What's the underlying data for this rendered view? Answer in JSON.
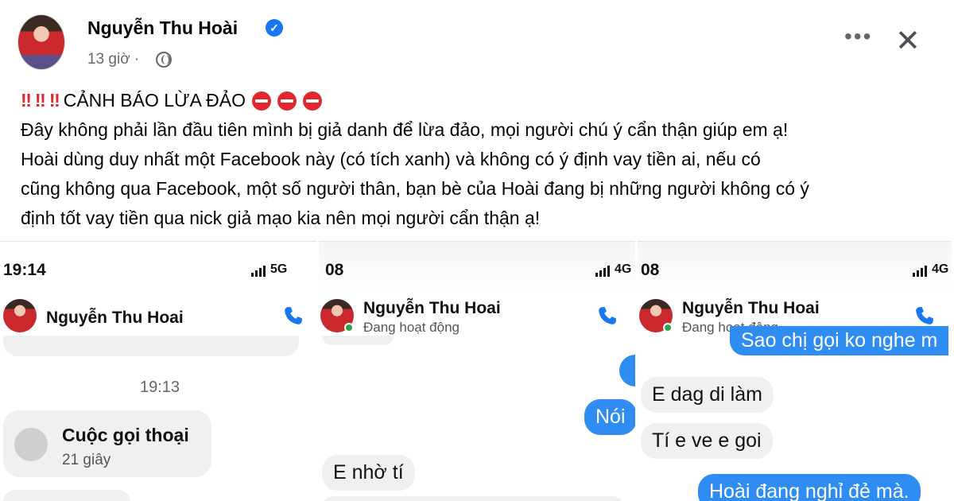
{
  "post": {
    "author": "Nguyễn Thu Hoài",
    "time": "13 giờ",
    "warning_title": "CẢNH BÁO LỪA ĐẢO",
    "lines": [
      "Đây không phải lần đầu tiên mình bị giả danh để lừa đảo, mọi người chú ý cẩn thận giúp em ạ!",
      "Hoài dùng duy nhất một Facebook này (có tích xanh) và không có ý định vay tiền ai, nếu có",
      "cũng không qua Facebook, một số người thân, bạn bè của Hoài đang bị những người không có ý",
      "định tốt vay tiền qua nick giả mạo kia nên mọi người cẩn thận ạ!"
    ],
    "accent_color": "#1877f2",
    "alert_color": "#e0262f"
  },
  "screenshots": [
    {
      "status_time": "19:14",
      "network": "5G",
      "contact_name": "Nguyễn Thu Hoai",
      "contact_status": "",
      "timestamp": "19:13",
      "call_title": "Cuộc gọi thoại",
      "call_duration": "21 giây"
    },
    {
      "status_time": "08",
      "network": "4G",
      "contact_name": "Nguyễn Thu Hoai",
      "contact_status": "Đang hoạt động",
      "messages": [
        {
          "dir": "out",
          "text": "Nói"
        },
        {
          "dir": "in",
          "text": "E nhờ tí"
        }
      ]
    },
    {
      "status_time": "08",
      "network": "4G",
      "contact_name": "Nguyễn Thu Hoai",
      "contact_status": "Đang hoạt động",
      "messages": [
        {
          "dir": "out",
          "text": "Sao chị gọi ko nghe m"
        },
        {
          "dir": "in",
          "text": "E dag di làm"
        },
        {
          "dir": "in",
          "text": "Tí e ve e goi"
        },
        {
          "dir": "out",
          "text": "Hoài đang nghỉ đẻ mà."
        }
      ]
    }
  ]
}
